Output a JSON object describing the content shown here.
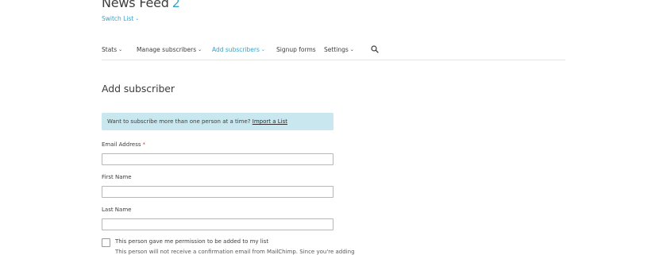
{
  "header": {
    "title": "News Feed",
    "count": "2",
    "switch_list": "Switch List"
  },
  "nav": {
    "items": [
      {
        "label": "Stats",
        "dropdown": true
      },
      {
        "label": "Manage subscribers",
        "dropdown": true
      },
      {
        "label": "Add subscribers",
        "dropdown": true,
        "active": true
      },
      {
        "label": "Signup forms",
        "dropdown": false
      },
      {
        "label": "Settings",
        "dropdown": true
      }
    ],
    "chevron": "⌄"
  },
  "page": {
    "title": "Add subscriber"
  },
  "banner": {
    "text": "Want to subscribe more than one person at a time?",
    "link": "Import a List"
  },
  "form": {
    "email_label": "Email Address",
    "required_mark": "*",
    "first_name_label": "First Name",
    "last_name_label": "Last Name",
    "email_value": "",
    "first_name_value": "",
    "last_name_value": "",
    "permission_label": "This person gave me permission to be added to my list",
    "permission_note": "This person will not receive a confirmation email from MailChimp. Since you're adding",
    "permission_checked": false
  },
  "colors": {
    "accent": "#3aa2c6",
    "banner_bg": "#c8e7ef",
    "required": "#d8412f"
  }
}
